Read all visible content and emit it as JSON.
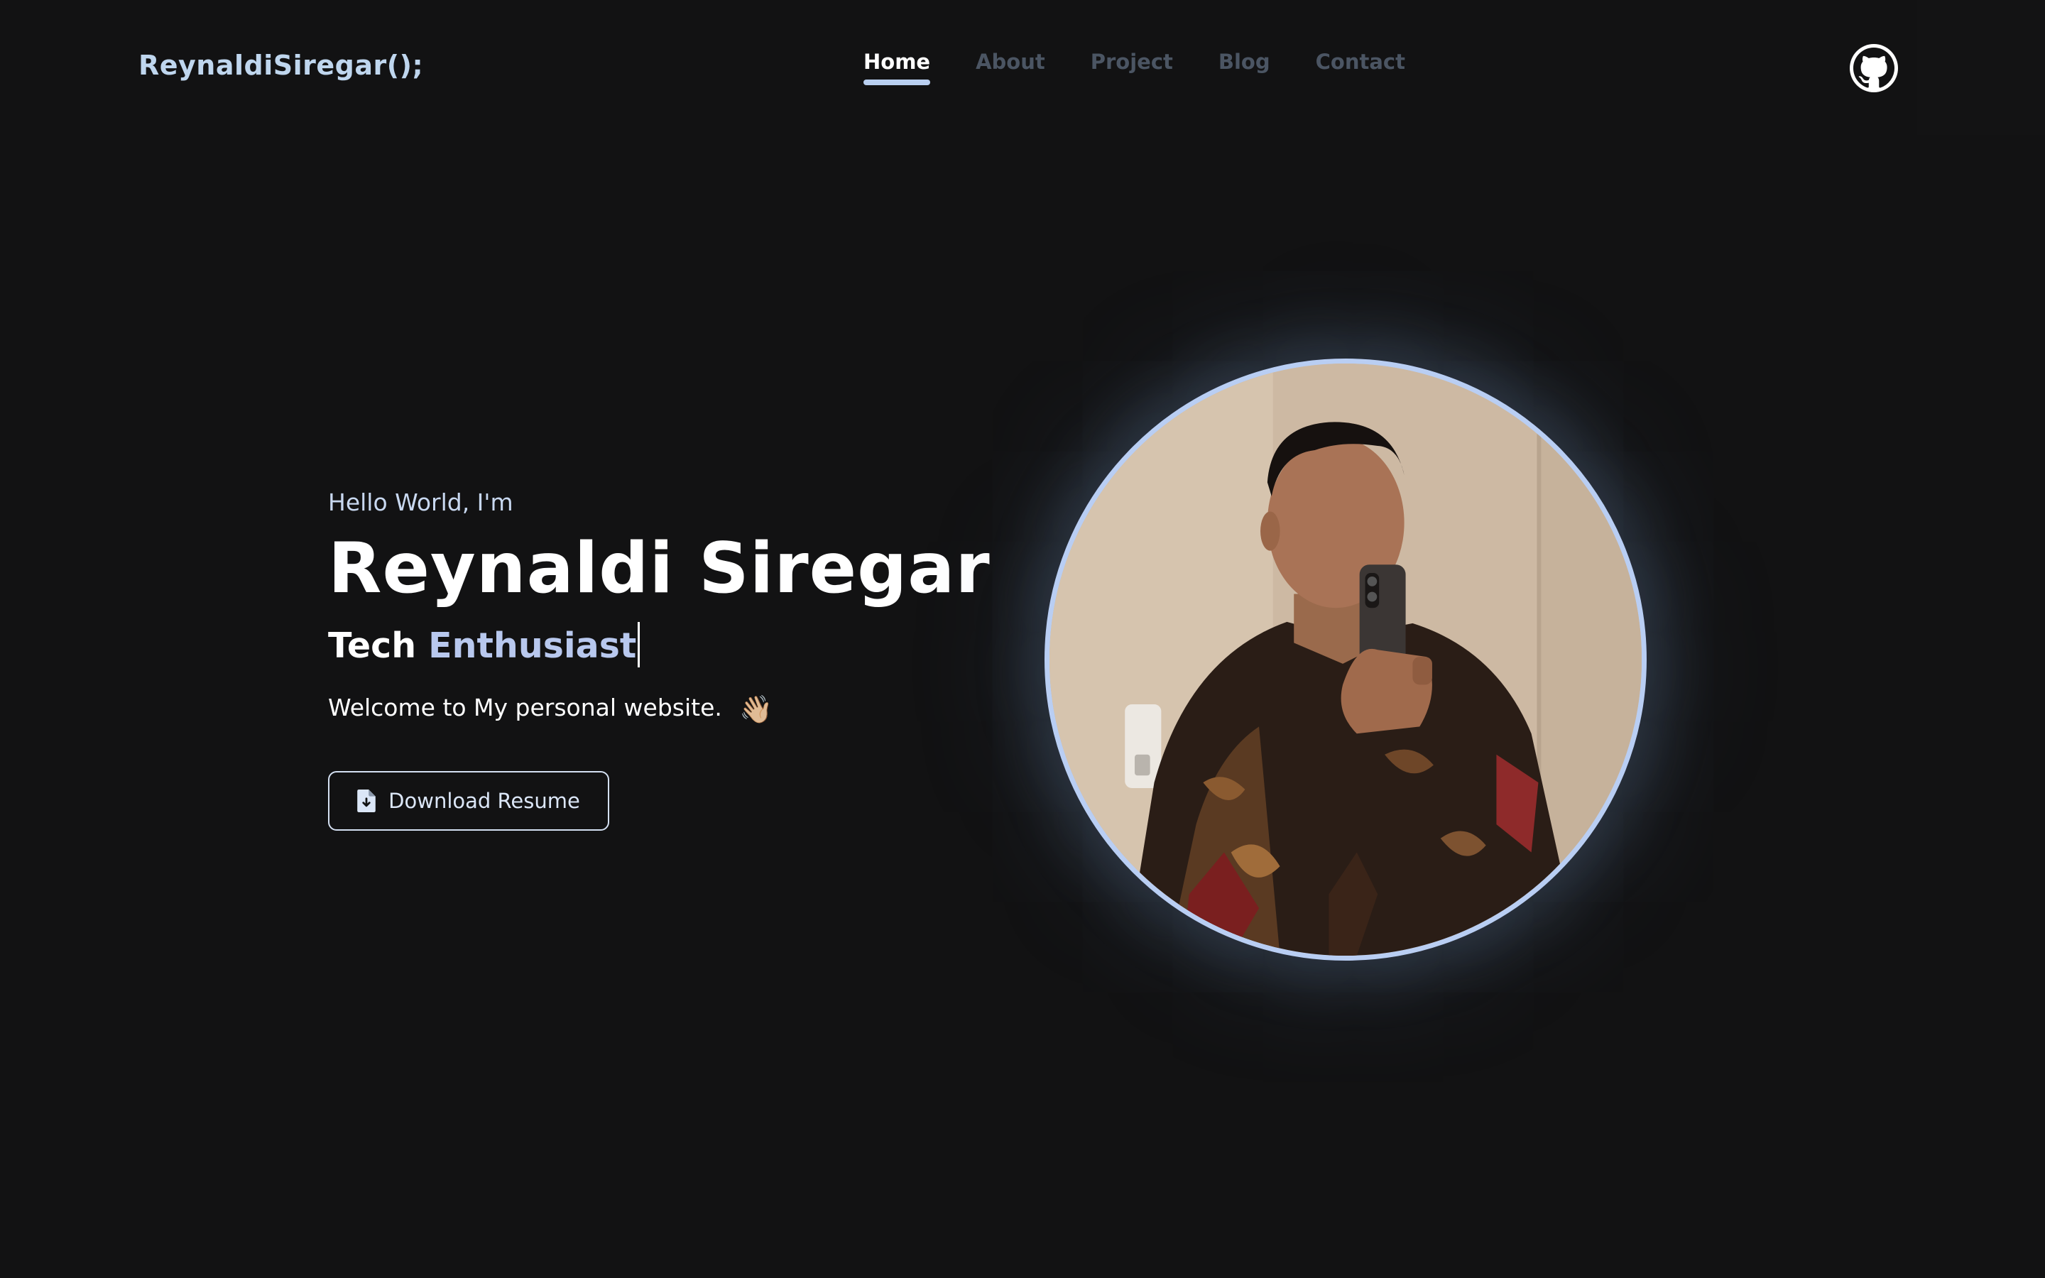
{
  "header": {
    "brand": "ReynaldiSiregar();",
    "nav": [
      {
        "label": "Home",
        "active": true
      },
      {
        "label": "About",
        "active": false
      },
      {
        "label": "Project",
        "active": false
      },
      {
        "label": "Blog",
        "active": false
      },
      {
        "label": "Contact",
        "active": false
      }
    ],
    "github_icon": "github-icon"
  },
  "hero": {
    "greeting": "Hello World, I'm",
    "name": "Reynaldi Siregar",
    "role_prefix": "Tech",
    "role_word": "Enthusiast",
    "welcome": "Welcome to My personal website.",
    "wave_emoji": "👋🏼",
    "resume_button": "Download Resume",
    "resume_icon": "file-download-icon"
  },
  "colors": {
    "background": "#121213",
    "accent": "#b9cef3",
    "brand": "#bfd6ee",
    "nav_inactive": "#4b5563"
  }
}
